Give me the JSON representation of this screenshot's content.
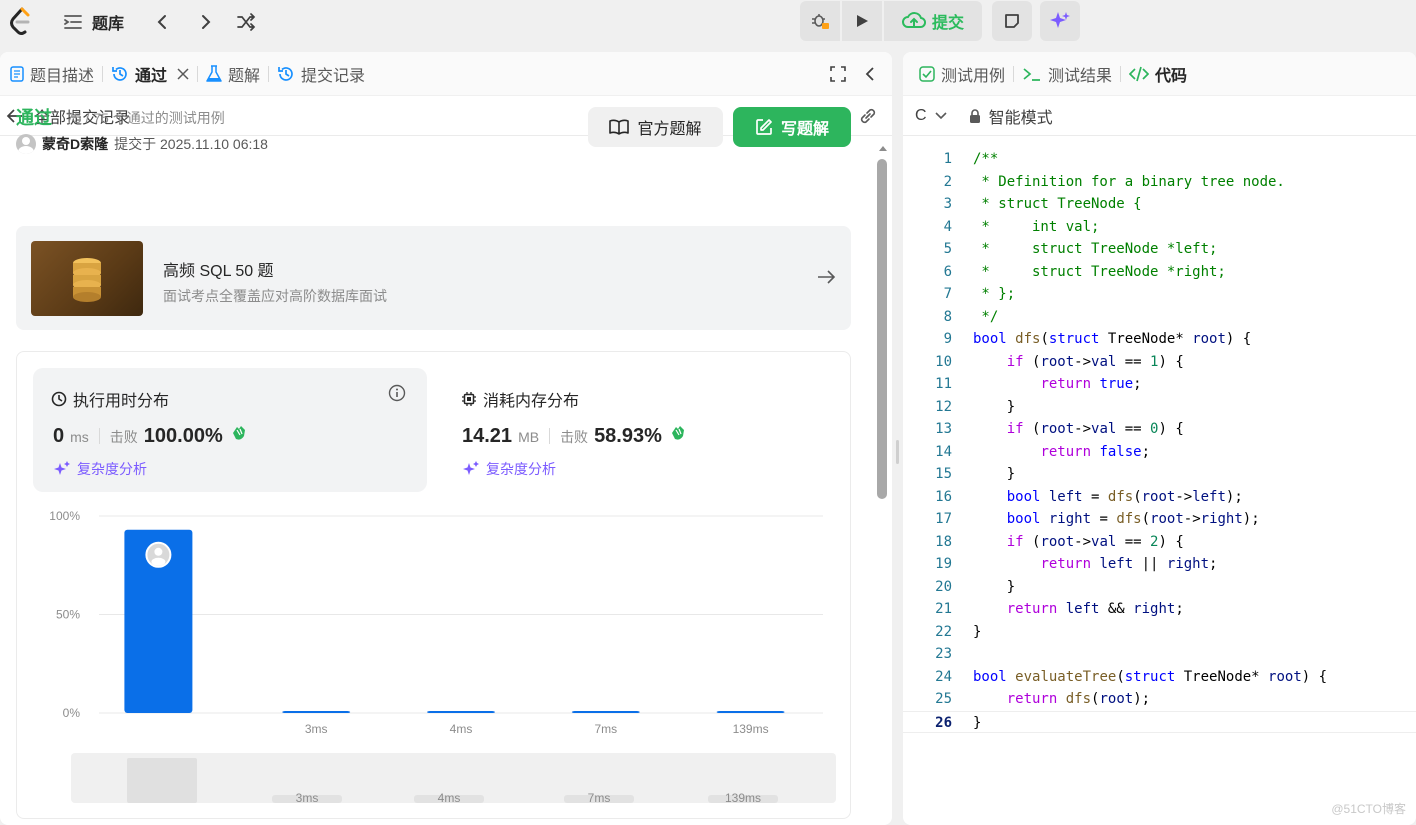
{
  "topbar": {
    "problemset_label": "题库",
    "submit_label": "提交"
  },
  "left_tabs": [
    {
      "label": "题目描述"
    },
    {
      "label": "通过"
    },
    {
      "label": "题解"
    },
    {
      "label": "提交记录"
    }
  ],
  "submission": {
    "back_label": "全部提交记录",
    "status": "通过",
    "cases": "75 / 75 个通过的测试用例",
    "author": "蒙奇D索隆",
    "submitted_at": "提交于 2025.11.10 06:18",
    "official_solution_label": "官方题解",
    "write_solution_label": "写题解"
  },
  "promo": {
    "title": "高频 SQL 50 题",
    "subtitle": "面试考点全覆盖应对高阶数据库面试"
  },
  "runtime": {
    "title": "执行用时分布",
    "value": "0",
    "unit": "ms",
    "beat_label": "击败",
    "beat_value": "100.00%",
    "complexity_label": "复杂度分析"
  },
  "memory": {
    "title": "消耗内存分布",
    "value": "14.21",
    "unit": "MB",
    "beat_label": "击败",
    "beat_value": "58.93%",
    "complexity_label": "复杂度分析"
  },
  "chart_data": {
    "type": "bar",
    "categories": [
      "",
      "3ms",
      "4ms",
      "7ms",
      "139ms"
    ],
    "values": [
      93,
      1,
      1,
      1,
      1
    ],
    "ylim": [
      0,
      100
    ],
    "yticks": [
      "100%",
      "50%",
      "0%"
    ],
    "xlabel": "",
    "ylabel": "",
    "bar_color": "#0a6fe8",
    "grid": true,
    "overview_labels": [
      "3ms",
      "4ms",
      "7ms",
      "139ms"
    ]
  },
  "right_tabs": [
    {
      "label": "测试用例"
    },
    {
      "label": "测试结果"
    },
    {
      "label": "代码"
    }
  ],
  "editor": {
    "language": "C",
    "mode_label": "智能模式",
    "lines": [
      "/**",
      " * Definition for a binary tree node.",
      " * struct TreeNode {",
      " *     int val;",
      " *     struct TreeNode *left;",
      " *     struct TreeNode *right;",
      " * };",
      " */",
      "bool dfs(struct TreeNode* root) {",
      "    if (root->val == 1) {",
      "        return true;",
      "    }",
      "    if (root->val == 0) {",
      "        return false;",
      "    }",
      "    bool left = dfs(root->left);",
      "    bool right = dfs(root->right);",
      "    if (root->val == 2) {",
      "        return left || right;",
      "    }",
      "    return left && right;",
      "}",
      "",
      "bool evaluateTree(struct TreeNode* root) {",
      "    return dfs(root);",
      "}"
    ]
  },
  "watermark": "@51CTO博客",
  "colors": {
    "accent_green": "#2db55d",
    "accent_blue": "#0a6fe8",
    "accent_purple": "#7c5cff"
  }
}
